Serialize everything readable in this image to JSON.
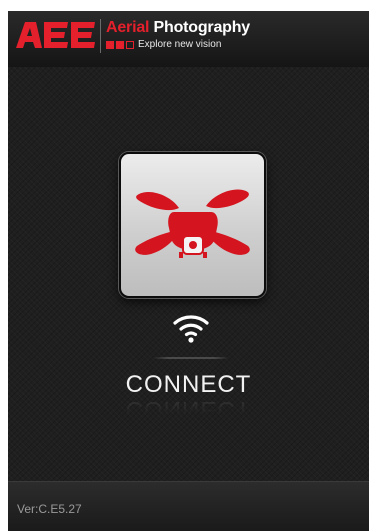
{
  "header": {
    "logo_brand": "AEE",
    "title_part1": "Aerial",
    "title_part2": "Photography",
    "subtitle": "Explore new vision"
  },
  "main": {
    "drone_button_icon": "drone-icon",
    "wifi_icon": "wifi-icon",
    "connect_label": "CONNECT"
  },
  "footer": {
    "version": "Ver:C.E5.27"
  },
  "colors": {
    "brand_red": "#e3202b",
    "background": "#1b1b1b",
    "text": "#f2f2f2"
  }
}
